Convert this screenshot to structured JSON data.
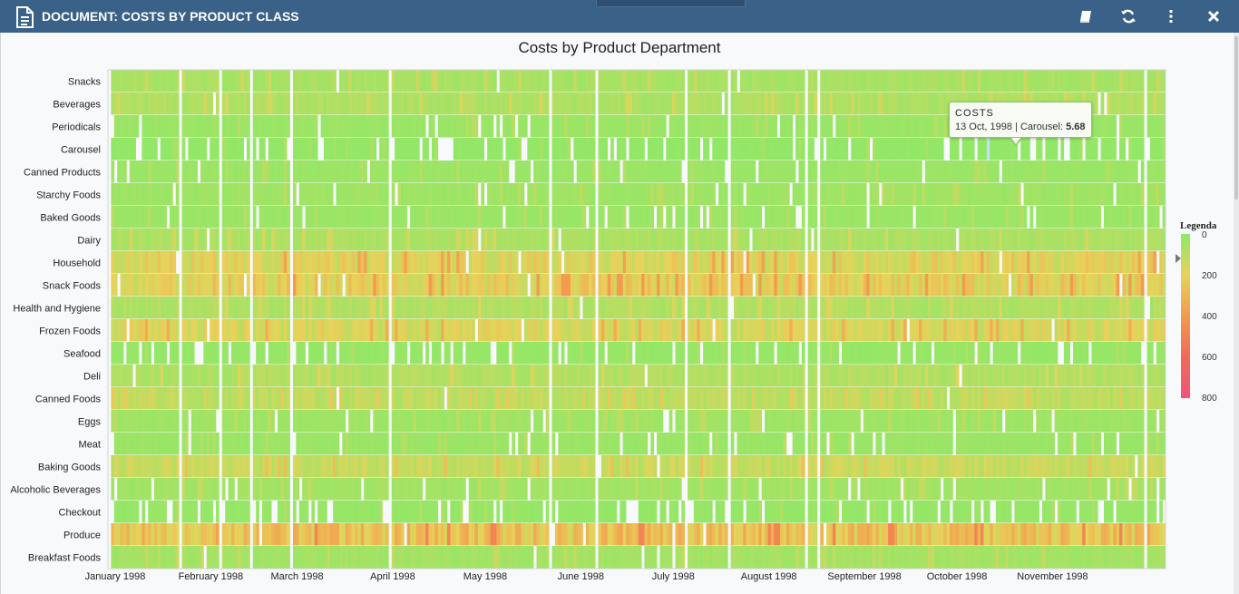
{
  "window": {
    "title": "DOCUMENT: COSTS BY PRODUCT CLASS",
    "icons": [
      "document-icon",
      "book-icon",
      "refresh-icon",
      "more-vertical-icon",
      "close-icon"
    ]
  },
  "tooltip": {
    "title": "COSTS",
    "text": "13 Oct, 1998 | Carousel: ",
    "value": "5.68"
  },
  "chart_data": {
    "type": "heatmap",
    "title": "Costs by Product Department",
    "rows": [
      "Snacks",
      "Beverages",
      "Periodicals",
      "Carousel",
      "Canned Products",
      "Starchy Foods",
      "Baked Goods",
      "Dairy",
      "Household",
      "Snack Foods",
      "Health and Hygiene",
      "Frozen Foods",
      "Seafood",
      "Deli",
      "Canned Foods",
      "Eggs",
      "Meat",
      "Baking Goods",
      "Alcoholic Beverages",
      "Checkout",
      "Produce",
      "Breakfast Foods"
    ],
    "row_levels": [
      60,
      75,
      30,
      12,
      30,
      40,
      30,
      70,
      190,
      210,
      80,
      170,
      20,
      80,
      110,
      40,
      30,
      130,
      45,
      20,
      260,
      50
    ],
    "x_labels": [
      "January 1998",
      "February 1998",
      "March 1998",
      "April 1998",
      "May 1998",
      "June 1998",
      "July 1998",
      "August 1998",
      "September 1998",
      "October 1998",
      "November 1998"
    ],
    "x_range": [
      "1998-01-01",
      "1998-12-10"
    ],
    "legend": {
      "title": "Legenda",
      "ticks": [
        "0",
        "200",
        "400",
        "600",
        "800"
      ],
      "min": 0,
      "max": 800,
      "colors": [
        "#8ee868",
        "#e8d25a",
        "#f29a4e",
        "#f06a5a",
        "#f2537a"
      ],
      "placement": "right"
    },
    "highlight": {
      "date": "13 Oct, 1998",
      "row": "Carousel",
      "value": 5.68,
      "color": "#bfe3f5"
    },
    "grid": false
  }
}
